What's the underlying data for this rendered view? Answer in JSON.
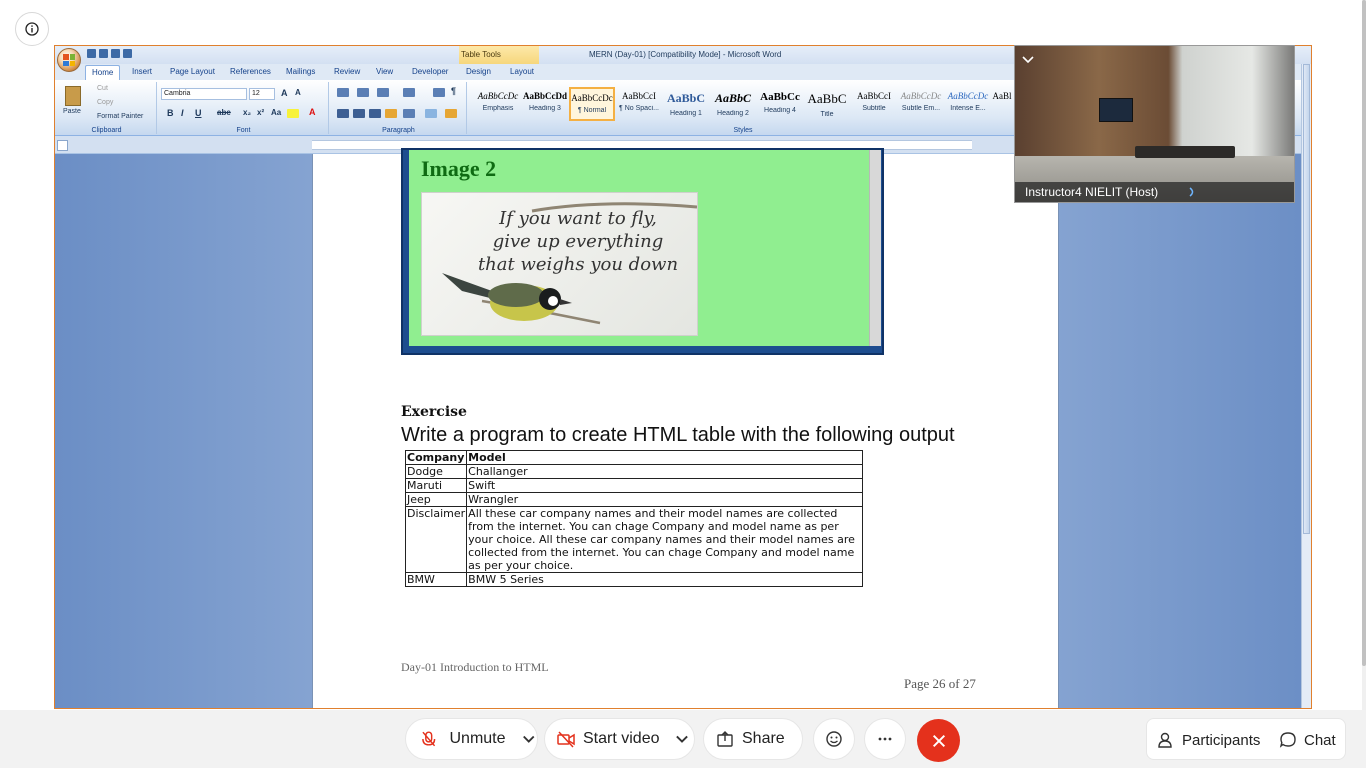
{
  "word": {
    "table_tools": "Table Tools",
    "window_title": "MERN (Day-01) [Compatibility Mode] - Microsoft Word",
    "tabs": [
      "Home",
      "Insert",
      "Page Layout",
      "References",
      "Mailings",
      "Review",
      "View",
      "Developer",
      "Design",
      "Layout"
    ],
    "clipboard": {
      "paste": "Paste",
      "cut": "Cut",
      "copy": "Copy",
      "format_painter": "Format Painter",
      "label": "Clipboard"
    },
    "font": {
      "name": "Cambria",
      "size": "12",
      "label": "Font"
    },
    "paragraph_label": "Paragraph",
    "styles_label": "Styles",
    "styles": [
      {
        "sample": "AaBbCcDc",
        "name": "Emphasis"
      },
      {
        "sample": "AaBbCcDd",
        "name": "Heading 3"
      },
      {
        "sample": "AaBbCcDc",
        "name": "¶ Normal"
      },
      {
        "sample": "AaBbCcI",
        "name": "¶ No Spaci..."
      },
      {
        "sample": "AaBbC",
        "name": "Heading 1"
      },
      {
        "sample": "AaBbC",
        "name": "Heading 2"
      },
      {
        "sample": "AaBbCc",
        "name": "Heading 4"
      },
      {
        "sample": "AaBbC",
        "name": "Title"
      },
      {
        "sample": "AaBbCcI",
        "name": "Subtitle"
      },
      {
        "sample": "AaBbCcDc",
        "name": "Subtle Em..."
      },
      {
        "sample": "AaBbCcDc",
        "name": "Intense E..."
      },
      {
        "sample": "AaBl",
        "name": ""
      }
    ]
  },
  "document": {
    "image_title": "Image 2",
    "quote_lines": [
      "If you want to fly,",
      "give up everything",
      "that weighs you down"
    ],
    "exercise_heading": "Exercise",
    "exercise_line": "Write a program to create HTML table with the following output",
    "table": {
      "headers": [
        "Company",
        "Model"
      ],
      "rows": [
        [
          "Dodge",
          "Challanger"
        ],
        [
          "Maruti",
          "Swift"
        ],
        [
          "Jeep",
          "Wrangler"
        ],
        [
          "Disclaimer",
          "All these car company names and their model names are collected from the internet. You can chage Company and model name as per your choice. All these car company names and their model names are collected from the internet. You can chage Company and model name as per your choice."
        ],
        [
          "BMW",
          "BMW 5 Series"
        ]
      ]
    },
    "footer_left": "Day-01 Introduction to HTML",
    "footer_right": "Page 26 of 27"
  },
  "video": {
    "participant": "Instructor4 NIELIT (Host)"
  },
  "meeting": {
    "unmute": "Unmute",
    "start_video": "Start video",
    "share": "Share",
    "participants": "Participants",
    "chat": "Chat",
    "colors": {
      "end": "#e4311c",
      "mic_off": "#e4311c"
    }
  }
}
